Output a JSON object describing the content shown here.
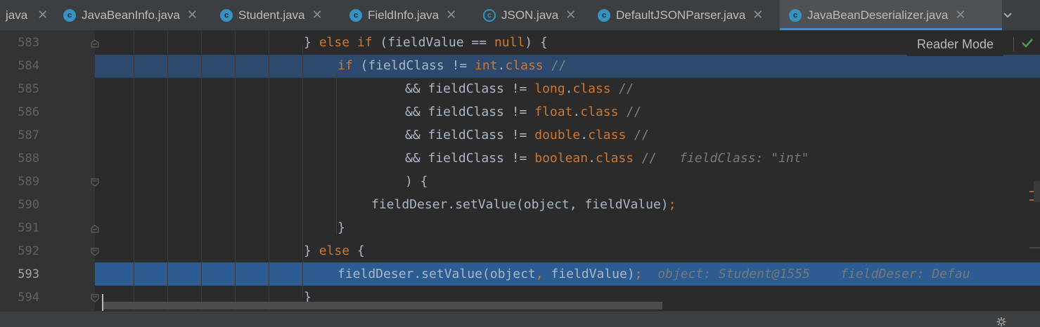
{
  "tabs": [
    {
      "label": "java",
      "icon": "none",
      "active": false
    },
    {
      "label": "JavaBeanInfo.java",
      "icon": "class-icon",
      "active": false
    },
    {
      "label": "Student.java",
      "icon": "class-icon",
      "active": false
    },
    {
      "label": "FieldInfo.java",
      "icon": "class-icon",
      "active": false
    },
    {
      "label": "JSON.java",
      "icon": "abstract-class-icon",
      "active": false
    },
    {
      "label": "DefaultJSONParser.java",
      "icon": "class-icon",
      "active": false
    },
    {
      "label": "JavaBeanDeserializer.java",
      "icon": "class-icon",
      "active": true
    }
  ],
  "tab_icon_letter": "c",
  "close_glyph": "✕",
  "more_glyph": "⌄",
  "reader_mode_label": "Reader Mode",
  "line_numbers": [
    "583",
    "584",
    "585",
    "586",
    "587",
    "588",
    "589",
    "590",
    "591",
    "592",
    "593",
    "594"
  ],
  "current_line": "593",
  "code": {
    "l583a": "} ",
    "l583b": "else if",
    "l583c": " (fieldValue == ",
    "l583d": "null",
    "l583e": ") {",
    "l584a": "if",
    "l584b": " (fieldClass != ",
    "l584c": "int",
    "l584d": ".",
    "l584e": "class",
    "l584f": " //",
    "l585a": "&& fieldClass != ",
    "l585b": "long",
    "l585c": ".",
    "l585d": "class",
    "l585e": " //",
    "l586a": "&& fieldClass != ",
    "l586b": "float",
    "l586c": ".",
    "l586d": "class",
    "l586e": " //",
    "l587a": "&& fieldClass != ",
    "l587b": "double",
    "l587c": ".",
    "l587d": "class",
    "l587e": " //",
    "l588a": "&& fieldClass != ",
    "l588b": "boolean",
    "l588c": ".",
    "l588d": "class",
    "l588e": " //",
    "l588hint": "fieldClass: \"int\"",
    "l589": ") {",
    "l590a": "fieldDeser.setValue(object, fieldValue)",
    "l590b": ";",
    "l591": "}",
    "l592a": "} ",
    "l592b": "else",
    "l592c": " {",
    "l593a": "fieldDeser.setValue(object",
    "l593b": ",",
    "l593c": " fieldValue)",
    "l593d": ";",
    "l593hint1": "object: Student@1555",
    "l593hint2": "fieldDeser: Defau",
    "l594": "}"
  },
  "colors": {
    "keyword": "#cc7832",
    "text": "#a9b7c6",
    "comment": "#808080",
    "accent": "#4a88c7",
    "exec_line": "#2d5c92",
    "check": "#4e9a51"
  }
}
